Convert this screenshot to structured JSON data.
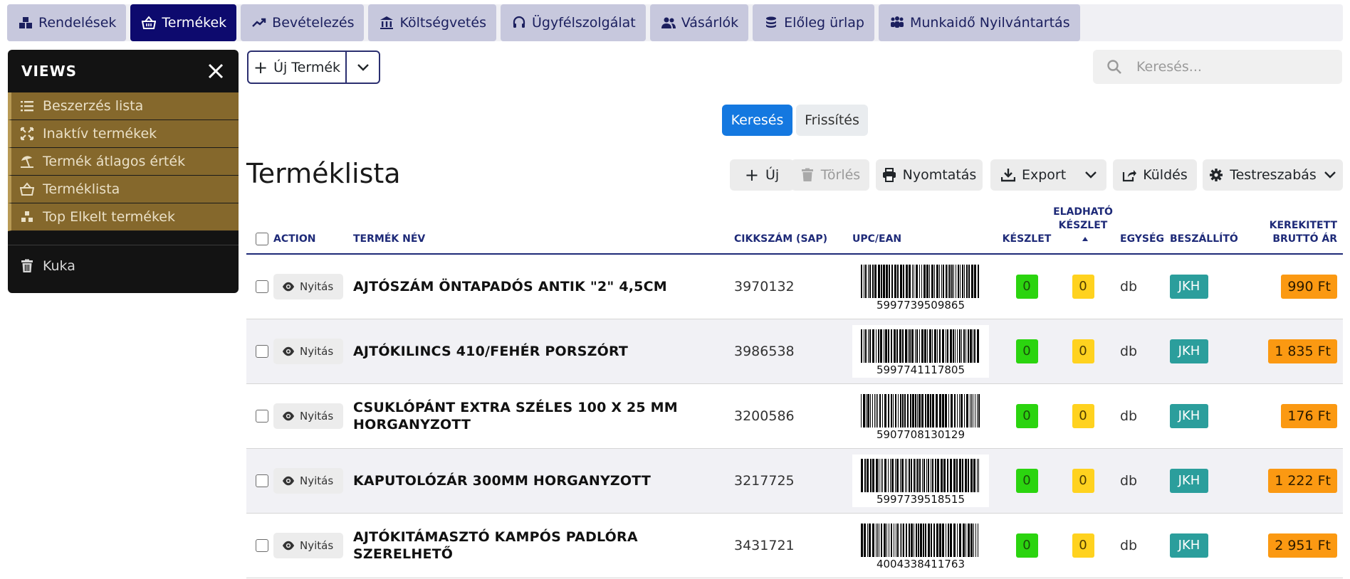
{
  "nav": {
    "tabs": [
      {
        "label": "Rendelések",
        "icon": "boxes-icon",
        "active": false
      },
      {
        "label": "Termékek",
        "icon": "basket-icon",
        "active": true
      },
      {
        "label": "Bevételezés",
        "icon": "trend-up-icon",
        "active": false
      },
      {
        "label": "Költségvetés",
        "icon": "bank-icon",
        "active": false
      },
      {
        "label": "Ügyfélszolgálat",
        "icon": "headset-icon",
        "active": false
      },
      {
        "label": "Vásárlók",
        "icon": "users-icon",
        "active": false
      },
      {
        "label": "Előleg ürlap",
        "icon": "coins-icon",
        "active": false
      },
      {
        "label": "Munkaidő Nyilvántartás",
        "icon": "people-group-icon",
        "active": false
      }
    ]
  },
  "sidebar": {
    "title": "VIEWS",
    "items": [
      {
        "label": "Beszerzés lista",
        "icon": "list-icon"
      },
      {
        "label": "Inaktív termékek",
        "icon": "expand-arrows-icon"
      },
      {
        "label": "Termék átlagos érték",
        "icon": "umbrella-beach-icon"
      },
      {
        "label": "Terméklista",
        "icon": "basket-icon"
      },
      {
        "label": "Top Elkelt termékek",
        "icon": "cubes-icon"
      }
    ],
    "trash_label": "Kuka"
  },
  "new_product": {
    "label": "Új Termék"
  },
  "search": {
    "placeholder": "Keresés..."
  },
  "query_buttons": {
    "search": "Keresés",
    "refresh": "Frissítés"
  },
  "list_title": "Terméklista",
  "toolbar": {
    "new": "Új",
    "delete": "Törlés",
    "print": "Nyomtatás",
    "export": "Export",
    "send": "Küldés",
    "customize": "Testreszabás"
  },
  "table": {
    "headers": {
      "action": "ACTION",
      "name": "TERMÉK NÉV",
      "sap": "CIKKSZÁM (SAP)",
      "upc": "UPC/EAN",
      "stock": "KÉSZLET",
      "sellable_line1": "ELADHATÓ",
      "sellable_line2": "KÉSZLET",
      "unit": "EGYSÉG",
      "supplier": "BESZÁLLÍTÓ",
      "price_line1": "KEREKITETT",
      "price_line2": "BRUTTÓ ÁR"
    },
    "open_label": "Nyitás",
    "rows": [
      {
        "name": "AJTÓSZÁM ÖNTAPADÓS ANTIK \"2\" 4,5CM",
        "sap": "3970132",
        "ean": "5997739509865",
        "stock": "0",
        "sellable": "0",
        "unit": "db",
        "supplier": "JKH",
        "price": "990 Ft"
      },
      {
        "name": "AJTÓKILINCS 410/FEHÉR PORSZÓRT",
        "sap": "3986538",
        "ean": "5997741117805",
        "stock": "0",
        "sellable": "0",
        "unit": "db",
        "supplier": "JKH",
        "price": "1 835 Ft"
      },
      {
        "name": "CSUKLÓPÁNT EXTRA SZÉLES 100 X 25 MM HORGANYZOTT",
        "sap": "3200586",
        "ean": "5907708130129",
        "stock": "0",
        "sellable": "0",
        "unit": "db",
        "supplier": "JKH",
        "price": "176 Ft"
      },
      {
        "name": "KAPUTOLÓZÁR 300MM HORGANYZOTT",
        "sap": "3217725",
        "ean": "5997739518515",
        "stock": "0",
        "sellable": "0",
        "unit": "db",
        "supplier": "JKH",
        "price": "1 222 Ft"
      },
      {
        "name": "AJTÓKITÁMASZTÓ KAMPÓS PADLÓRA SZERELHETŐ",
        "sap": "3431721",
        "ean": "4004338411763",
        "stock": "0",
        "sellable": "0",
        "unit": "db",
        "supplier": "JKH",
        "price": "2 951 Ft"
      }
    ]
  },
  "colors": {
    "nav_active": "#0d0a6e",
    "nav_tab": "#c7c8dd",
    "sidebar_bg": "#131313",
    "sidebar_item": "#85682c",
    "primary": "#1478e0",
    "stock_badge": "#2bd40f",
    "sellable_badge": "#ffd21f",
    "supplier_badge": "#2b9e9c",
    "price_badge": "#fb9912"
  }
}
